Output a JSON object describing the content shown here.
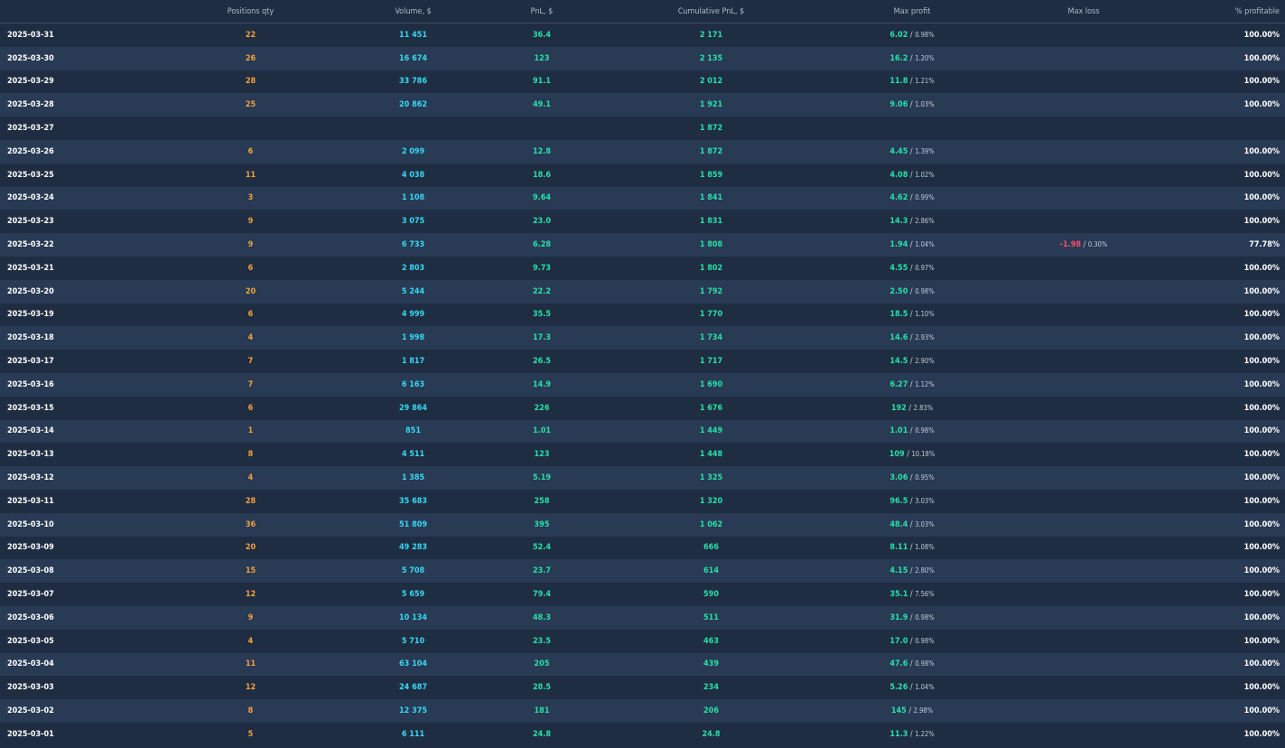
{
  "columns": [
    {
      "key": "date",
      "label": ""
    },
    {
      "key": "qty",
      "label": "Positions qty"
    },
    {
      "key": "volume",
      "label": "Volume, $"
    },
    {
      "key": "pnl",
      "label": "PnL, $"
    },
    {
      "key": "cum_pnl",
      "label": "Cumulative PnL, $"
    },
    {
      "key": "max_profit",
      "label": "Max profit"
    },
    {
      "key": "max_loss",
      "label": "Max loss"
    },
    {
      "key": "pct_profitable",
      "label": "% profitable"
    }
  ],
  "rows": [
    {
      "date": "2025-03-31",
      "qty": "22",
      "volume": "11 451",
      "pnl": "36.4",
      "cum_pnl": "2 171",
      "max_profit": "6.02",
      "max_profit_pct": "0.98%",
      "max_loss": "",
      "max_loss_pct": "",
      "pct_profitable": "100.00%"
    },
    {
      "date": "2025-03-30",
      "qty": "26",
      "volume": "16 674",
      "pnl": "123",
      "cum_pnl": "2 135",
      "max_profit": "16.2",
      "max_profit_pct": "1.20%",
      "max_loss": "",
      "max_loss_pct": "",
      "pct_profitable": "100.00%"
    },
    {
      "date": "2025-03-29",
      "qty": "28",
      "volume": "33 786",
      "pnl": "91.1",
      "cum_pnl": "2 012",
      "max_profit": "11.8",
      "max_profit_pct": "1.21%",
      "max_loss": "",
      "max_loss_pct": "",
      "pct_profitable": "100.00%"
    },
    {
      "date": "2025-03-28",
      "qty": "25",
      "volume": "20 862",
      "pnl": "49.1",
      "cum_pnl": "1 921",
      "max_profit": "9.06",
      "max_profit_pct": "1.03%",
      "max_loss": "",
      "max_loss_pct": "",
      "pct_profitable": "100.00%"
    },
    {
      "date": "2025-03-27",
      "qty": "",
      "volume": "",
      "pnl": "",
      "cum_pnl": "1 872",
      "max_profit": "",
      "max_profit_pct": "",
      "max_loss": "",
      "max_loss_pct": "",
      "pct_profitable": ""
    },
    {
      "date": "2025-03-26",
      "qty": "6",
      "volume": "2 099",
      "pnl": "12.8",
      "cum_pnl": "1 872",
      "max_profit": "4.45",
      "max_profit_pct": "1.39%",
      "max_loss": "",
      "max_loss_pct": "",
      "pct_profitable": "100.00%"
    },
    {
      "date": "2025-03-25",
      "qty": "11",
      "volume": "4 038",
      "pnl": "18.6",
      "cum_pnl": "1 859",
      "max_profit": "4.08",
      "max_profit_pct": "1.02%",
      "max_loss": "",
      "max_loss_pct": "",
      "pct_profitable": "100.00%"
    },
    {
      "date": "2025-03-24",
      "qty": "3",
      "volume": "1 108",
      "pnl": "9.64",
      "cum_pnl": "1 841",
      "max_profit": "4.62",
      "max_profit_pct": "0.99%",
      "max_loss": "",
      "max_loss_pct": "",
      "pct_profitable": "100.00%"
    },
    {
      "date": "2025-03-23",
      "qty": "9",
      "volume": "3 075",
      "pnl": "23.0",
      "cum_pnl": "1 831",
      "max_profit": "14.3",
      "max_profit_pct": "2.86%",
      "max_loss": "",
      "max_loss_pct": "",
      "pct_profitable": "100.00%"
    },
    {
      "date": "2025-03-22",
      "qty": "9",
      "volume": "6 733",
      "pnl": "6.28",
      "cum_pnl": "1 808",
      "max_profit": "1.94",
      "max_profit_pct": "1.04%",
      "max_loss": "-1.98",
      "max_loss_pct": "0.30%",
      "pct_profitable": "77.78%"
    },
    {
      "date": "2025-03-21",
      "qty": "6",
      "volume": "2 803",
      "pnl": "9.73",
      "cum_pnl": "1 802",
      "max_profit": "4.55",
      "max_profit_pct": "0.97%",
      "max_loss": "",
      "max_loss_pct": "",
      "pct_profitable": "100.00%"
    },
    {
      "date": "2025-03-20",
      "qty": "20",
      "volume": "5 244",
      "pnl": "22.2",
      "cum_pnl": "1 792",
      "max_profit": "2.50",
      "max_profit_pct": "0.98%",
      "max_loss": "",
      "max_loss_pct": "",
      "pct_profitable": "100.00%"
    },
    {
      "date": "2025-03-19",
      "qty": "6",
      "volume": "4 999",
      "pnl": "35.5",
      "cum_pnl": "1 770",
      "max_profit": "18.5",
      "max_profit_pct": "1.10%",
      "max_loss": "",
      "max_loss_pct": "",
      "pct_profitable": "100.00%"
    },
    {
      "date": "2025-03-18",
      "qty": "4",
      "volume": "1 998",
      "pnl": "17.3",
      "cum_pnl": "1 734",
      "max_profit": "14.6",
      "max_profit_pct": "2.93%",
      "max_loss": "",
      "max_loss_pct": "",
      "pct_profitable": "100.00%"
    },
    {
      "date": "2025-03-17",
      "qty": "7",
      "volume": "1 817",
      "pnl": "26.5",
      "cum_pnl": "1 717",
      "max_profit": "14.5",
      "max_profit_pct": "2.90%",
      "max_loss": "",
      "max_loss_pct": "",
      "pct_profitable": "100.00%"
    },
    {
      "date": "2025-03-16",
      "qty": "7",
      "volume": "6 163",
      "pnl": "14.9",
      "cum_pnl": "1 690",
      "max_profit": "6.27",
      "max_profit_pct": "1.12%",
      "max_loss": "",
      "max_loss_pct": "",
      "pct_profitable": "100.00%"
    },
    {
      "date": "2025-03-15",
      "qty": "6",
      "volume": "29 864",
      "pnl": "226",
      "cum_pnl": "1 676",
      "max_profit": "192",
      "max_profit_pct": "2.83%",
      "max_loss": "",
      "max_loss_pct": "",
      "pct_profitable": "100.00%"
    },
    {
      "date": "2025-03-14",
      "qty": "1",
      "volume": "851",
      "pnl": "1.01",
      "cum_pnl": "1 449",
      "max_profit": "1.01",
      "max_profit_pct": "0.98%",
      "max_loss": "",
      "max_loss_pct": "",
      "pct_profitable": "100.00%"
    },
    {
      "date": "2025-03-13",
      "qty": "8",
      "volume": "4 511",
      "pnl": "123",
      "cum_pnl": "1 448",
      "max_profit": "109",
      "max_profit_pct": "10.18%",
      "max_loss": "",
      "max_loss_pct": "",
      "pct_profitable": "100.00%"
    },
    {
      "date": "2025-03-12",
      "qty": "4",
      "volume": "1 385",
      "pnl": "5.19",
      "cum_pnl": "1 325",
      "max_profit": "3.06",
      "max_profit_pct": "0.95%",
      "max_loss": "",
      "max_loss_pct": "",
      "pct_profitable": "100.00%"
    },
    {
      "date": "2025-03-11",
      "qty": "28",
      "volume": "35 683",
      "pnl": "258",
      "cum_pnl": "1 320",
      "max_profit": "96.5",
      "max_profit_pct": "3.03%",
      "max_loss": "",
      "max_loss_pct": "",
      "pct_profitable": "100.00%"
    },
    {
      "date": "2025-03-10",
      "qty": "36",
      "volume": "51 809",
      "pnl": "395",
      "cum_pnl": "1 062",
      "max_profit": "48.4",
      "max_profit_pct": "3.03%",
      "max_loss": "",
      "max_loss_pct": "",
      "pct_profitable": "100.00%"
    },
    {
      "date": "2025-03-09",
      "qty": "20",
      "volume": "49 283",
      "pnl": "52.4",
      "cum_pnl": "666",
      "max_profit": "8.11",
      "max_profit_pct": "1.08%",
      "max_loss": "",
      "max_loss_pct": "",
      "pct_profitable": "100.00%"
    },
    {
      "date": "2025-03-08",
      "qty": "15",
      "volume": "5 708",
      "pnl": "23.7",
      "cum_pnl": "614",
      "max_profit": "4.15",
      "max_profit_pct": "2.80%",
      "max_loss": "",
      "max_loss_pct": "",
      "pct_profitable": "100.00%"
    },
    {
      "date": "2025-03-07",
      "qty": "12",
      "volume": "5 659",
      "pnl": "79.4",
      "cum_pnl": "590",
      "max_profit": "35.1",
      "max_profit_pct": "7.56%",
      "max_loss": "",
      "max_loss_pct": "",
      "pct_profitable": "100.00%"
    },
    {
      "date": "2025-03-06",
      "qty": "9",
      "volume": "10 134",
      "pnl": "48.3",
      "cum_pnl": "511",
      "max_profit": "31.9",
      "max_profit_pct": "0.98%",
      "max_loss": "",
      "max_loss_pct": "",
      "pct_profitable": "100.00%"
    },
    {
      "date": "2025-03-05",
      "qty": "4",
      "volume": "5 710",
      "pnl": "23.5",
      "cum_pnl": "463",
      "max_profit": "17.0",
      "max_profit_pct": "0.98%",
      "max_loss": "",
      "max_loss_pct": "",
      "pct_profitable": "100.00%"
    },
    {
      "date": "2025-03-04",
      "qty": "11",
      "volume": "63 104",
      "pnl": "205",
      "cum_pnl": "439",
      "max_profit": "47.6",
      "max_profit_pct": "0.98%",
      "max_loss": "",
      "max_loss_pct": "",
      "pct_profitable": "100.00%"
    },
    {
      "date": "2025-03-03",
      "qty": "12",
      "volume": "24 687",
      "pnl": "28.5",
      "cum_pnl": "234",
      "max_profit": "5.26",
      "max_profit_pct": "1.04%",
      "max_loss": "",
      "max_loss_pct": "",
      "pct_profitable": "100.00%"
    },
    {
      "date": "2025-03-02",
      "qty": "8",
      "volume": "12 375",
      "pnl": "181",
      "cum_pnl": "206",
      "max_profit": "145",
      "max_profit_pct": "2.98%",
      "max_loss": "",
      "max_loss_pct": "",
      "pct_profitable": "100.00%"
    },
    {
      "date": "2025-03-01",
      "qty": "5",
      "volume": "6 111",
      "pnl": "24.8",
      "cum_pnl": "24.8",
      "max_profit": "11.3",
      "max_profit_pct": "1.22%",
      "max_loss": "",
      "max_loss_pct": "",
      "pct_profitable": "100.00%"
    }
  ],
  "colors": {
    "background": "#1f2d42",
    "row_alt": "#283a54",
    "qty": "#f5a13a",
    "volume": "#37d8f2",
    "profit": "#27e0a8",
    "loss": "#ff4d68"
  }
}
